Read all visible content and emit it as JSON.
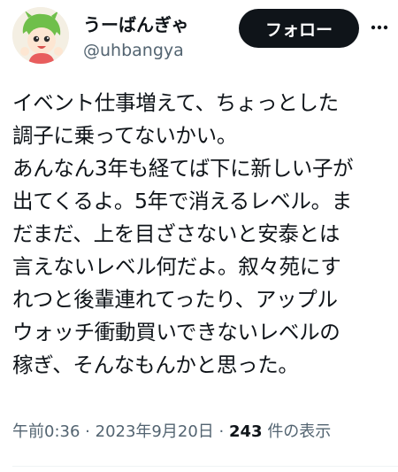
{
  "author": {
    "display_name": "うーばんぎゃ",
    "handle": "@uhbangya",
    "avatar_icon": "avatar-cartoon-character"
  },
  "actions": {
    "follow_label": "フォロー",
    "more_icon": "more-horizontal-icon"
  },
  "tweet": {
    "text": "イベント仕事増えて、ちょっとした\n調子に乗ってないかい。\nあんなん3年も経てば下に新しい子が\n出てくるよ。5年で消えるレベル。ま\nだまだ、上を目ざさないと安泰とは\n言えないレベル何だよ。叙々苑にす\nれつと後輩連れてったり、アップル\nウォッチ衝動買いできないレベルの\n稼ぎ、そんなもんかと思った。"
  },
  "meta": {
    "time": "午前0:36",
    "separator": "·",
    "date": "2023年9月20日",
    "views_count": "243",
    "views_label": "件の表示"
  },
  "colors": {
    "text_primary": "#0f1419",
    "text_secondary": "#536471",
    "button_bg": "#0f1419",
    "button_text": "#ffffff"
  }
}
